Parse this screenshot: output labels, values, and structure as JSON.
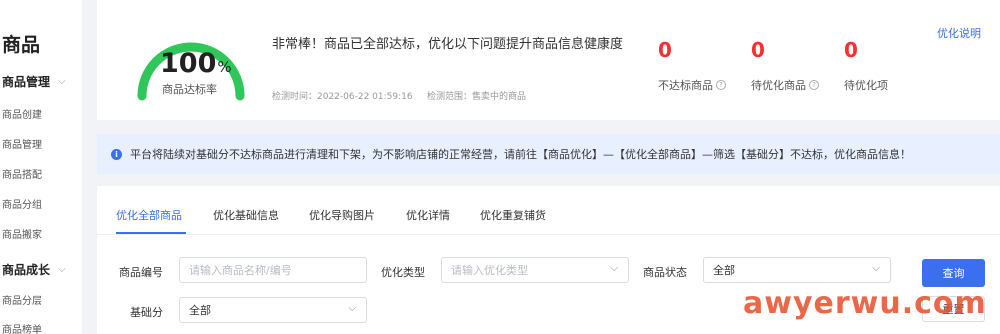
{
  "sidebar": {
    "title": "商品",
    "groups": [
      {
        "label": "商品管理",
        "items": [
          "商品创建",
          "商品管理",
          "商品搭配",
          "商品分组",
          "商品搬家"
        ]
      },
      {
        "label": "商品成长",
        "items": [
          "商品分层",
          "商品榜单"
        ]
      }
    ]
  },
  "summary": {
    "score": "100",
    "score_unit": "%",
    "score_label": "商品达标率",
    "score_fraction": 1.0,
    "message": "非常棒！商品已全部达标，优化以下问题提升商品信息健康度",
    "detect_time": "检测时间：2022-06-22 01:59:16",
    "detect_scope": "检测范围：售卖中的商品",
    "stats": [
      {
        "value": "0",
        "label": "不达标商品",
        "has_help": true
      },
      {
        "value": "0",
        "label": "待优化商品",
        "has_help": true
      },
      {
        "value": "0",
        "label": "待优化项",
        "has_help": false
      }
    ],
    "explain_link": "优化说明"
  },
  "notice": {
    "icon": "info-icon",
    "text": "平台将陆续对基础分不达标商品进行清理和下架，为不影响店铺的正常经营，请前往【商品优化】—【优化全部商品】—筛选【基础分】不达标，优化商品信息！"
  },
  "tabs": [
    "优化全部商品",
    "优化基础信息",
    "优化导购图片",
    "优化详情",
    "优化重复铺货"
  ],
  "filters": {
    "product_id": {
      "label": "商品编号",
      "placeholder": "请输入商品名称/编号"
    },
    "opt_type": {
      "label": "优化类型",
      "placeholder": "请输入优化类型"
    },
    "status": {
      "label": "商品状态",
      "value": "全部"
    },
    "base_score": {
      "label": "基础分",
      "value": "全部"
    }
  },
  "buttons": {
    "query": "查询",
    "reset": "重置"
  },
  "watermark": "awyerwu.com",
  "colors": {
    "accent": "#3a6ff0",
    "gauge": "#2fc75a",
    "alert": "#ff2d2d",
    "notice_bg": "#e8efff"
  }
}
